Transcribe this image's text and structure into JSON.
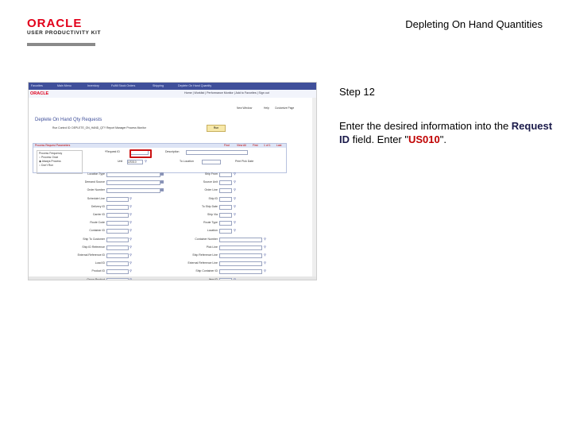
{
  "branding": {
    "logo_top": "ORACLE",
    "logo_bottom": "USER PRODUCTIVITY KIT"
  },
  "document_title": "Depleting On Hand Quantities",
  "step": {
    "label": "Step 12"
  },
  "instruction": {
    "prefix": "Enter the desired information into the ",
    "field": "Request ID",
    "middle": " field. Enter \"",
    "value": "US010",
    "suffix": "\"."
  },
  "screenshot": {
    "menubar": [
      "Favorites",
      "Main Menu",
      "Inventory",
      "Fulfill Stock Orders",
      "Shipping",
      "Deplete On Hand Quantity"
    ],
    "header_links": "Home | Worklist | Performance Monitor | Add to Favorites | Sign out",
    "breadcrumb_right": [
      "New Window",
      "Help",
      "Customize Page"
    ],
    "page_title": "Deplete On Hand Qty Requests",
    "run_control": "Run Control ID: DEPLETE_ON_HAND_QTY   Report Manager   Process Monitor",
    "run_button": "Run",
    "panel_header": "Process Request Parameters",
    "pager": [
      "Find",
      "View All",
      "First",
      "1 of 1",
      "Last"
    ],
    "frequency_title": "Process Frequency",
    "frequency_options": [
      "Process Once",
      "Always Process",
      "Don't Run"
    ],
    "request_id_label": "*Request ID",
    "description_label": "Description",
    "unit_label": "Unit",
    "unit_value": "US010",
    "to_location_label": "To Location",
    "fields_left": [
      "Location Type",
      "Demand Source",
      "Order Number",
      "Schedule Line",
      "Delivery ID",
      "Carrier ID",
      "Route Code",
      "Container ID",
      "Ship To Customer",
      "Ship ID Reference",
      "External Reference ID",
      "Load ID",
      "Product ID",
      "Group Product"
    ],
    "fields_right": [
      "Ship From",
      "Source Unit",
      "Order Line",
      "Ship ID",
      "To Ship Date",
      "Ship Via",
      "Route Type",
      "Location",
      "Container Number",
      "Pick Line",
      "Ship Reference Line",
      "External Reference Line",
      "Ship Container ID",
      "Item ID"
    ],
    "checkbox_label": "Print Pick Date",
    "to_label": "To"
  },
  "colors": {
    "brand_red": "#e2001a",
    "highlight": "#cc1111",
    "psft_blue": "#3f4f9a"
  }
}
